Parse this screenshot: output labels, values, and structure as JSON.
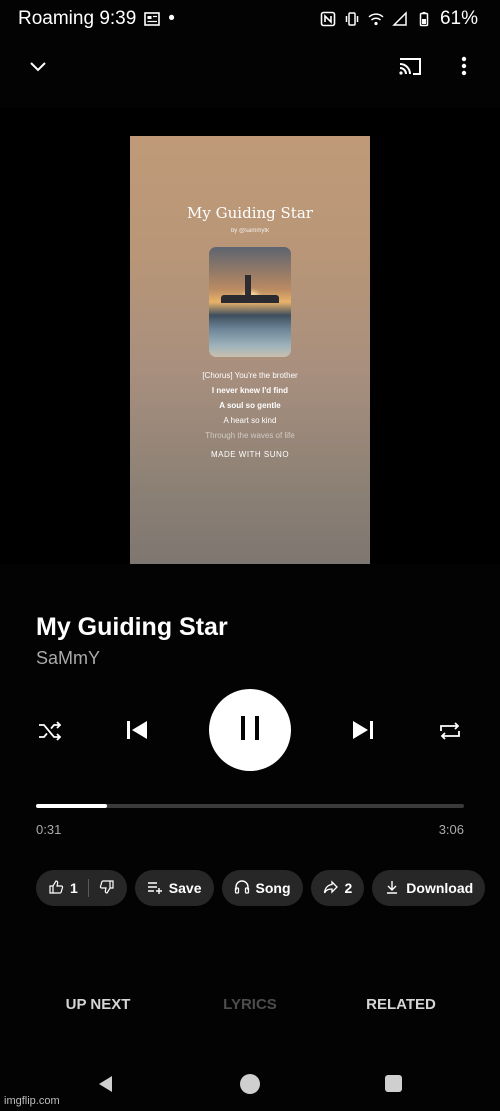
{
  "status_bar": {
    "left_text": "Roaming 9:39",
    "dot": "•",
    "battery": "61%",
    "icons": [
      "news-icon",
      "nfc-icon",
      "vibrate-icon",
      "wifi-icon",
      "signal-icon",
      "battery-icon"
    ]
  },
  "top_bar": {
    "icons": [
      "chevron-down-icon",
      "cast-icon",
      "more-vert-icon"
    ]
  },
  "video": {
    "title": "My Guiding Star",
    "subtitle": "by @sammytk",
    "lyrics": [
      "[Chorus] You're the brother",
      "I never knew I'd find",
      "A soul so gentle",
      "A heart so kind",
      "Through the waves of life"
    ],
    "made_with": "MADE WITH SUNO"
  },
  "track": {
    "title": "My Guiding Star",
    "artist": "SaMmY"
  },
  "controls": {
    "icons": [
      "shuffle-icon",
      "skip-previous-icon",
      "pause-icon",
      "skip-next-icon",
      "repeat-icon"
    ]
  },
  "progress": {
    "current": "0:31",
    "total": "3:06",
    "fraction": 0.167
  },
  "chips": {
    "like_count": "1",
    "save": "Save",
    "song": "Song",
    "share_count": "2",
    "download": "Download"
  },
  "tabs": {
    "up_next": "UP NEXT",
    "lyrics": "LYRICS",
    "related": "RELATED"
  },
  "watermark": "imgflip.com",
  "colors": {
    "background": "#030303",
    "chip": "#272727",
    "muted": "#aaaaaa"
  }
}
